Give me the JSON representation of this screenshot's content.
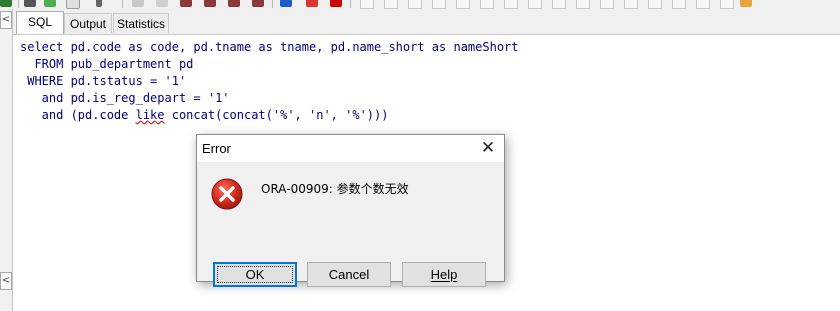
{
  "tabs": [
    {
      "label": "SQL",
      "active": true
    },
    {
      "label": "Output",
      "active": false
    },
    {
      "label": "Statistics",
      "active": false
    }
  ],
  "gutter": {
    "arrow_top": "<",
    "arrow_bottom": "<"
  },
  "editor": {
    "line1": "select pd.code as code, pd.tname as tname, pd.name_short as nameShort",
    "line2": "  FROM pub_department pd",
    "line3": " WHERE pd.tstatus = '1'",
    "line4": "   and pd.is_reg_depart = '1'",
    "line5_pre": "   and (pd.code ",
    "line5_squiggle": "like",
    "line5_post": " concat(concat('%', 'n', '%')))",
    "text_color": "#000080"
  },
  "dialog": {
    "title": "Error",
    "close_glyph": "✕",
    "message": "ORA-00909: 参数个数无效",
    "icon": "error-icon",
    "buttons": {
      "ok": "OK",
      "cancel": "Cancel",
      "help": "Help"
    },
    "accent_color": "#0078d7",
    "icon_color": "#c42b1c"
  }
}
